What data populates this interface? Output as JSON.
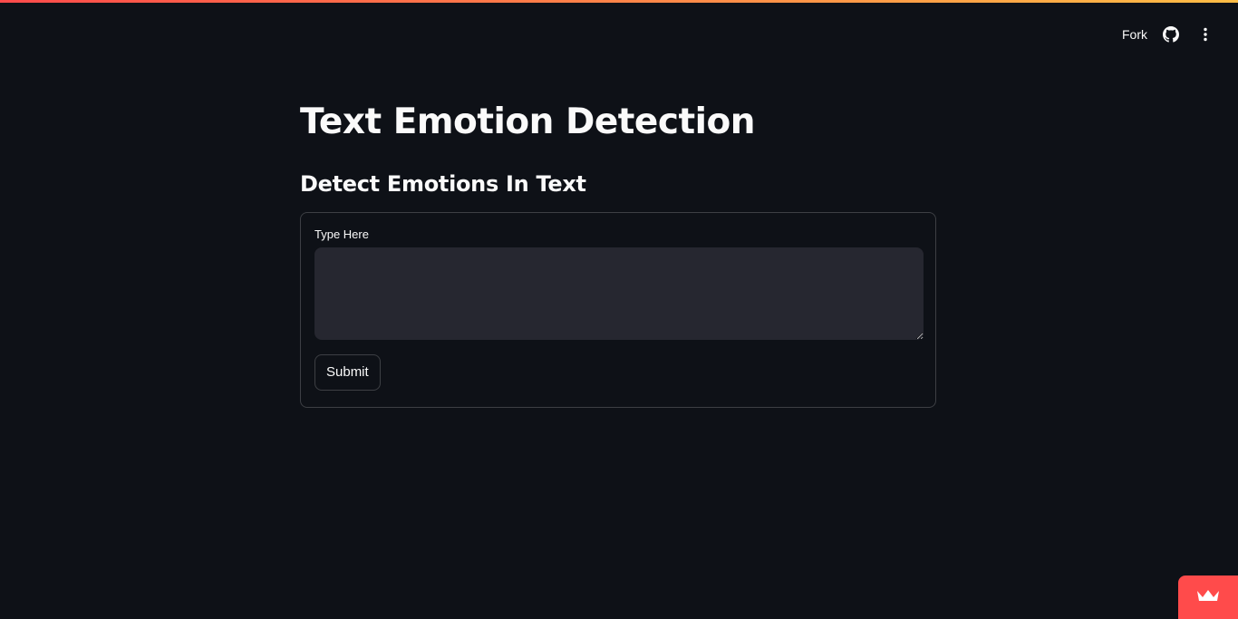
{
  "header": {
    "fork_label": "Fork",
    "github_icon": "github-icon",
    "menu_icon": "kebab-menu-icon"
  },
  "main": {
    "title": "Text Emotion Detection",
    "subtitle": "Detect Emotions In Text",
    "form": {
      "field_label": "Type Here",
      "textarea_value": "",
      "submit_label": "Submit"
    }
  },
  "badge": {
    "icon": "crown-icon"
  },
  "colors": {
    "background": "#0e1117",
    "input_background": "#262730",
    "accent": "#ff4b4b",
    "stripe_start": "#ff4b4b",
    "stripe_end": "#ffbd45",
    "text": "#fafafa"
  }
}
